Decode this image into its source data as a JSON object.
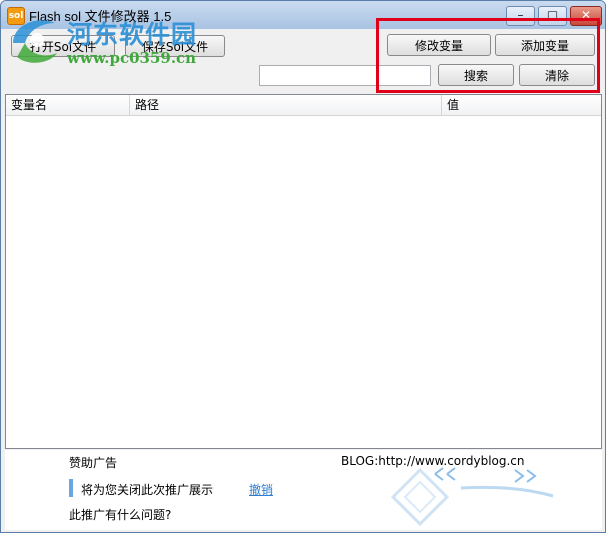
{
  "window": {
    "title": "Flash sol 文件修改器 1.5",
    "app_icon_text": "sol"
  },
  "titlebar_buttons": {
    "minimize": "–",
    "maximize": "□",
    "close": "✕"
  },
  "watermark": {
    "name": "河东软件园",
    "url": "www.pc0359.cn"
  },
  "toolbar": {
    "open_label": "打开Sol文件",
    "save_label": "保存Sol文件",
    "modify_label": "修改变量",
    "add_label": "添加变量",
    "search_label": "搜索",
    "clear_label": "清除",
    "search_value": ""
  },
  "table": {
    "columns": [
      "变量名",
      "路径",
      "值"
    ],
    "rows": []
  },
  "ad": {
    "label": "赞助广告",
    "blog": "BLOG:http://www.cordyblog.cn",
    "message": "将为您关闭此次推广展示",
    "undo_label": "撤销",
    "question": "此推广有什么问题?"
  },
  "colors": {
    "highlight": "#e0001a",
    "link": "#2f7fd0",
    "watermark_name": "#2a8fd6",
    "watermark_url": "#3fa83a"
  }
}
